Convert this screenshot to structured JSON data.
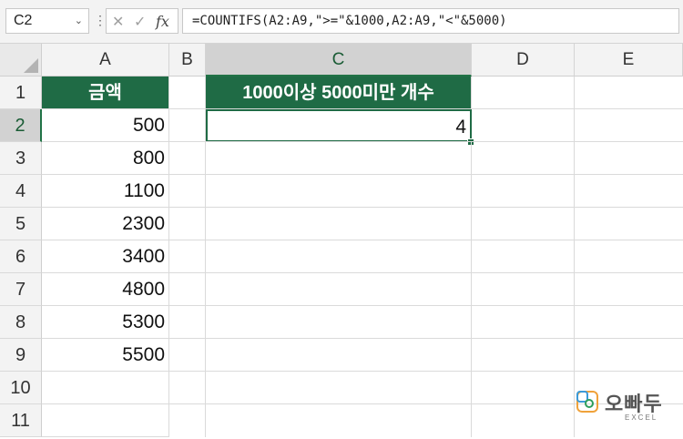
{
  "formula_bar": {
    "name_box": "C2",
    "formula": "=COUNTIFS(A2:A9,\">=\"&1000,A2:A9,\"<\"&5000)",
    "fx_label": "fx"
  },
  "columns": [
    "A",
    "B",
    "C",
    "D",
    "E"
  ],
  "rows": [
    "1",
    "2",
    "3",
    "4",
    "5",
    "6",
    "7",
    "8",
    "9",
    "10",
    "11"
  ],
  "cells": {
    "a1": "금액",
    "a_values": [
      "500",
      "800",
      "1100",
      "2300",
      "3400",
      "4800",
      "5300",
      "5500"
    ],
    "c1": "1000이상 5000미만 개수",
    "c2": "4"
  },
  "logo": {
    "brand": "오빠두",
    "sub": "EXCEL"
  },
  "colors": {
    "accent": "#1f6b45",
    "header_bg": "#f3f3f3"
  }
}
